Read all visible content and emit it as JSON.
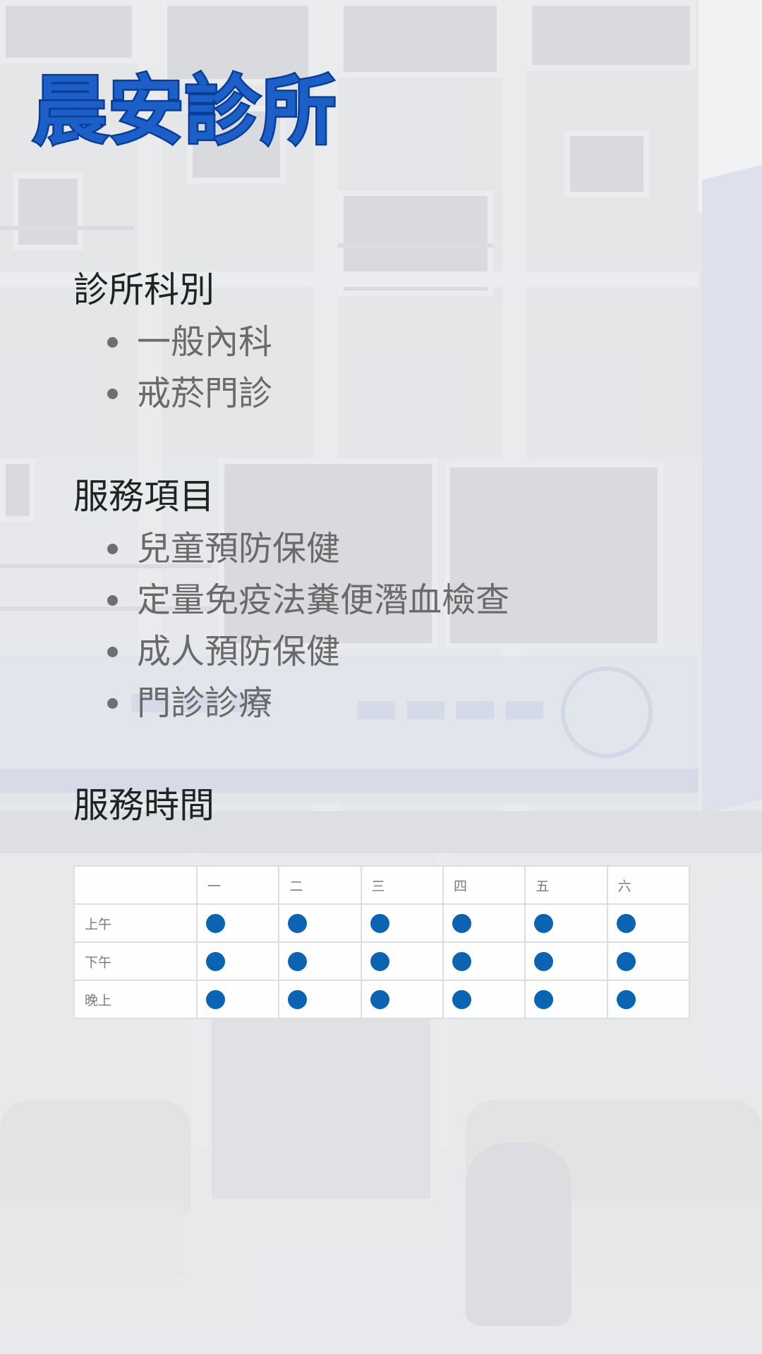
{
  "title": "晨安診所",
  "colors": {
    "title_fill": "#1b5fc7",
    "title_outline": "#0a3d99",
    "open_dot": "#0b64b2"
  },
  "departments": {
    "heading": "診所科別",
    "items": [
      "一般內科",
      "戒菸門診"
    ]
  },
  "services": {
    "heading": "服務項目",
    "items": [
      "兒童預防保健",
      "定量免疫法糞便潛血檢查",
      "成人預防保健",
      "門診診療"
    ]
  },
  "hours": {
    "heading": "服務時間",
    "days": [
      "一",
      "二",
      "三",
      "四",
      "五",
      "六"
    ],
    "sessions": [
      {
        "label": "上午",
        "open": [
          true,
          true,
          true,
          true,
          true,
          true
        ]
      },
      {
        "label": "下午",
        "open": [
          true,
          true,
          true,
          true,
          true,
          true
        ]
      },
      {
        "label": "晚上",
        "open": [
          true,
          true,
          true,
          true,
          true,
          true
        ]
      }
    ]
  }
}
